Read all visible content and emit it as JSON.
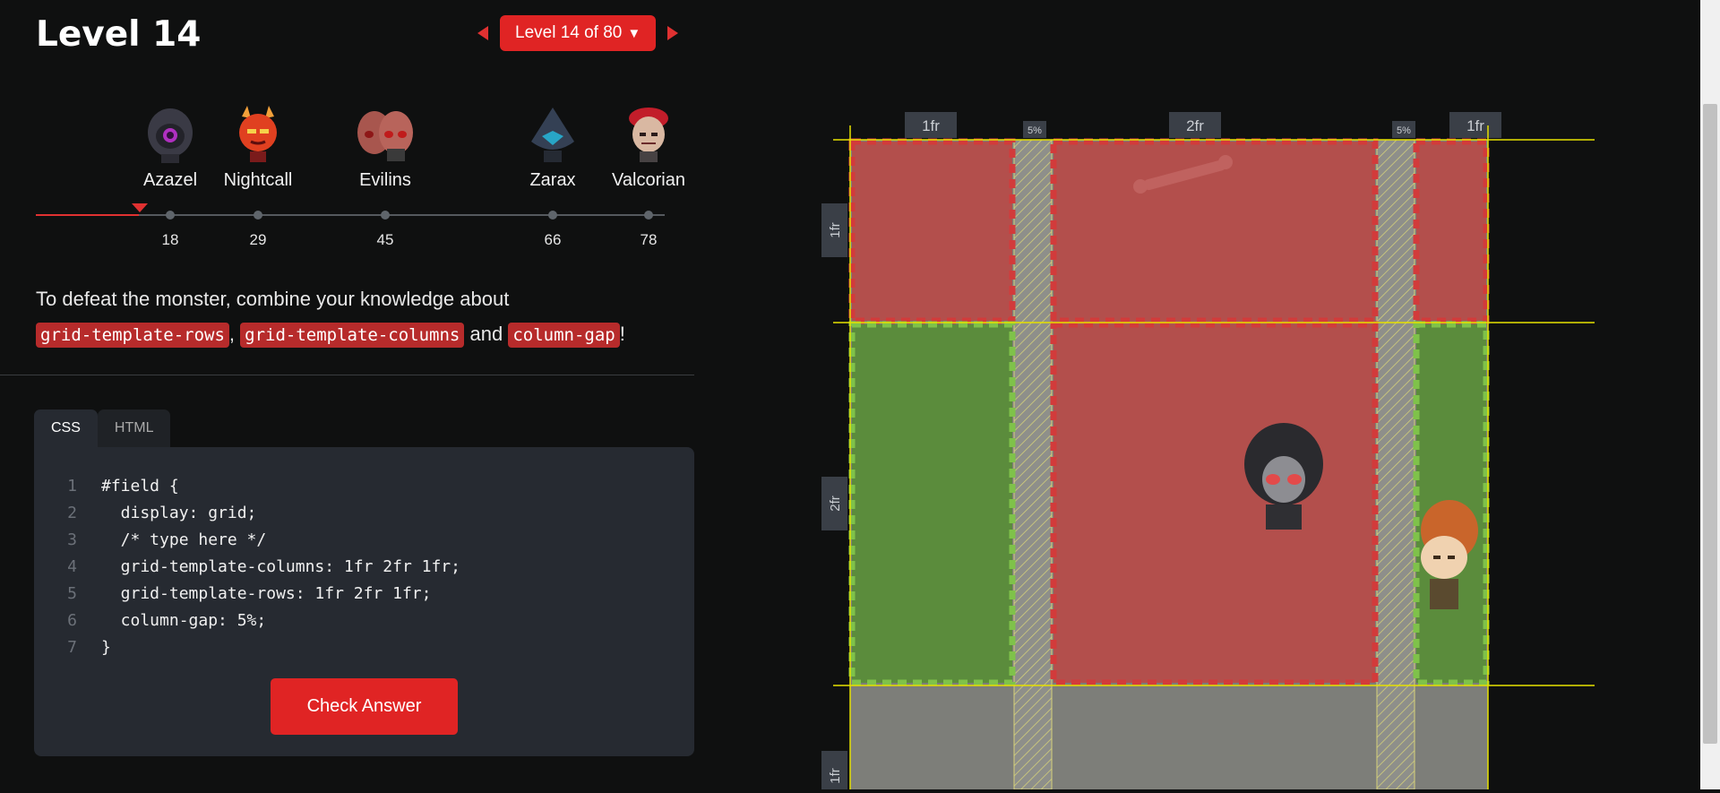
{
  "header": {
    "title": "Level 14",
    "level_selector": "Level 14 of 80"
  },
  "timeline": {
    "current_level": 14,
    "monsters": [
      {
        "name": "Azazel",
        "level": "18"
      },
      {
        "name": "Nightcall",
        "level": "29"
      },
      {
        "name": "Evilins",
        "level": "45"
      },
      {
        "name": "Zarax",
        "level": "66"
      },
      {
        "name": "Valcorian",
        "level": "78"
      }
    ]
  },
  "instructions": {
    "text_before": "To defeat the monster, combine your knowledge about",
    "props": [
      "grid-template-rows",
      "grid-template-columns",
      "column-gap"
    ],
    "sep1": ",",
    "sep2": "and",
    "end": "!"
  },
  "editor": {
    "tabs": [
      "CSS",
      "HTML"
    ],
    "active_tab": "CSS",
    "lines": [
      "#field {",
      "  display: grid;",
      "  /* type here */",
      "  grid-template-columns: 1fr 2fr 1fr;",
      "  grid-template-rows: 1fr 2fr 1fr;",
      "  column-gap: 5%;",
      "}"
    ],
    "line_numbers": [
      "1",
      "2",
      "3",
      "4",
      "5",
      "6",
      "7"
    ],
    "check_button": "Check Answer"
  },
  "field": {
    "column_labels": [
      "1fr",
      "5%",
      "2fr",
      "5%",
      "1fr"
    ],
    "row_labels": [
      "1fr",
      "2fr",
      "1fr"
    ],
    "colors": {
      "red_cell": "#b34f4c",
      "green_cell": "#5b8c3c",
      "gap": "#8e8f8a",
      "guide": "#e6e100"
    }
  }
}
